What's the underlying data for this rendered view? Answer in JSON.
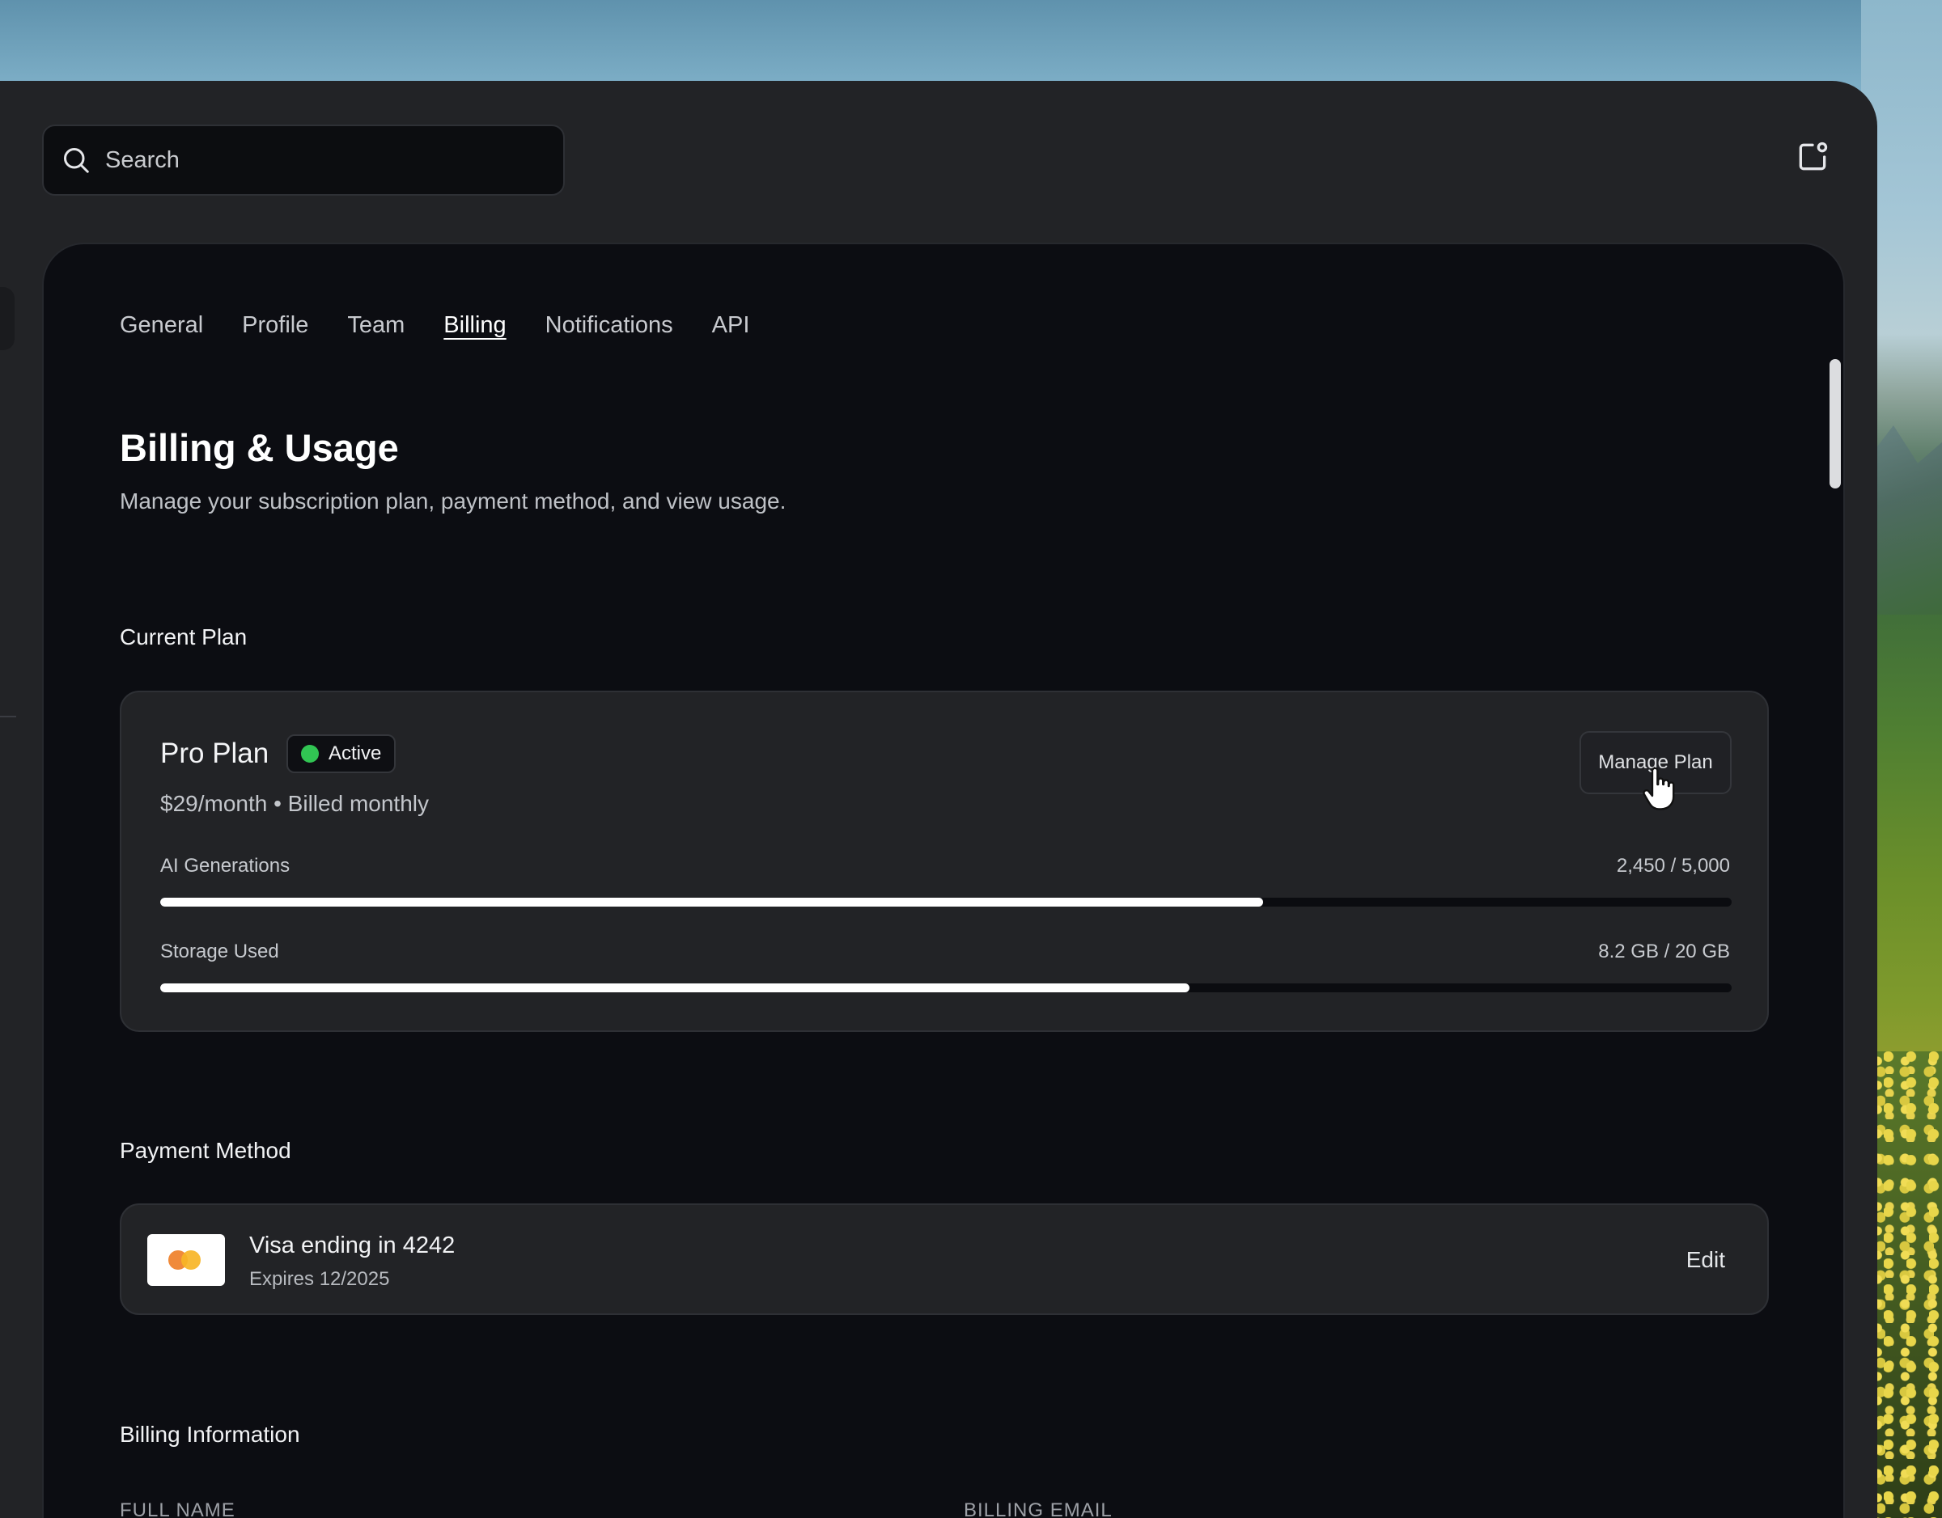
{
  "search": {
    "placeholder": "Search"
  },
  "tabs": [
    {
      "label": "General"
    },
    {
      "label": "Profile"
    },
    {
      "label": "Team"
    },
    {
      "label": "Billing",
      "active": true
    },
    {
      "label": "Notifications"
    },
    {
      "label": "API"
    }
  ],
  "page": {
    "title": "Billing & Usage",
    "subtitle": "Manage your subscription plan, payment method, and view usage."
  },
  "current_plan": {
    "section_label": "Current Plan",
    "plan_name": "Pro Plan",
    "status": "Active",
    "status_color": "#31c553",
    "price": "$29/month • Billed monthly",
    "manage_label": "Manage Plan",
    "usage": [
      {
        "label": "AI Generations",
        "value": "2,450 / 5,000",
        "fraction": 0.702
      },
      {
        "label": "Storage Used",
        "value": "8.2 GB / 20 GB",
        "fraction": 0.655
      }
    ]
  },
  "payment_method": {
    "section_label": "Payment Method",
    "card_title": "Visa ending in 4242",
    "card_expiry": "Expires 12/2025",
    "edit_label": "Edit"
  },
  "billing_information": {
    "section_label": "Billing Information",
    "full_name_label": "FULL NAME",
    "billing_email_label": "BILLING EMAIL"
  },
  "icons": {
    "search": "search-icon",
    "share": "share-icon",
    "cursor": "hand-pointer-icon"
  }
}
